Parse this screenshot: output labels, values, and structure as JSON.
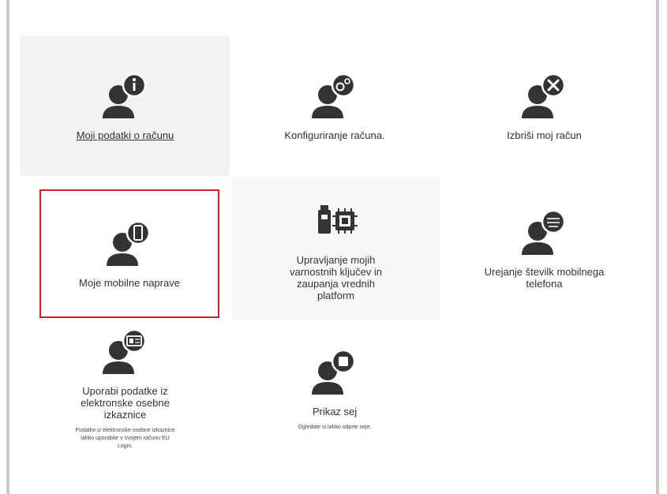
{
  "tiles": [
    {
      "label": "Moji podatki o računu",
      "icon": "user-info-icon"
    },
    {
      "label": "Konfiguriranje računa.",
      "icon": "user-settings-icon"
    },
    {
      "label": "Izbriši moj račun",
      "icon": "user-delete-icon"
    },
    {
      "label": "Moje mobilne naprave",
      "icon": "user-mobile-device-icon"
    },
    {
      "label": "Upravljanje mojih varnostnih ključev in zaupanja vrednih platform",
      "icon": "security-key-chip-icon"
    },
    {
      "label": "Urejanje številk mobilnega telefona",
      "icon": "user-phone-number-icon"
    },
    {
      "label": "Uporabi podatke iz elektronske osebne izkaznice",
      "description": "Podatke iz elektronske osebne izkaznice lahko uporabite v svojem računu EU Login.",
      "icon": "user-id-card-icon"
    },
    {
      "label": "Prikaz sej",
      "description": "Ogledate si lahko odprte seje.",
      "icon": "user-sessions-icon"
    }
  ],
  "colors": {
    "selected_border": "#d0202b",
    "icon": "#333333",
    "tile_bg": "#f2f2f2"
  }
}
